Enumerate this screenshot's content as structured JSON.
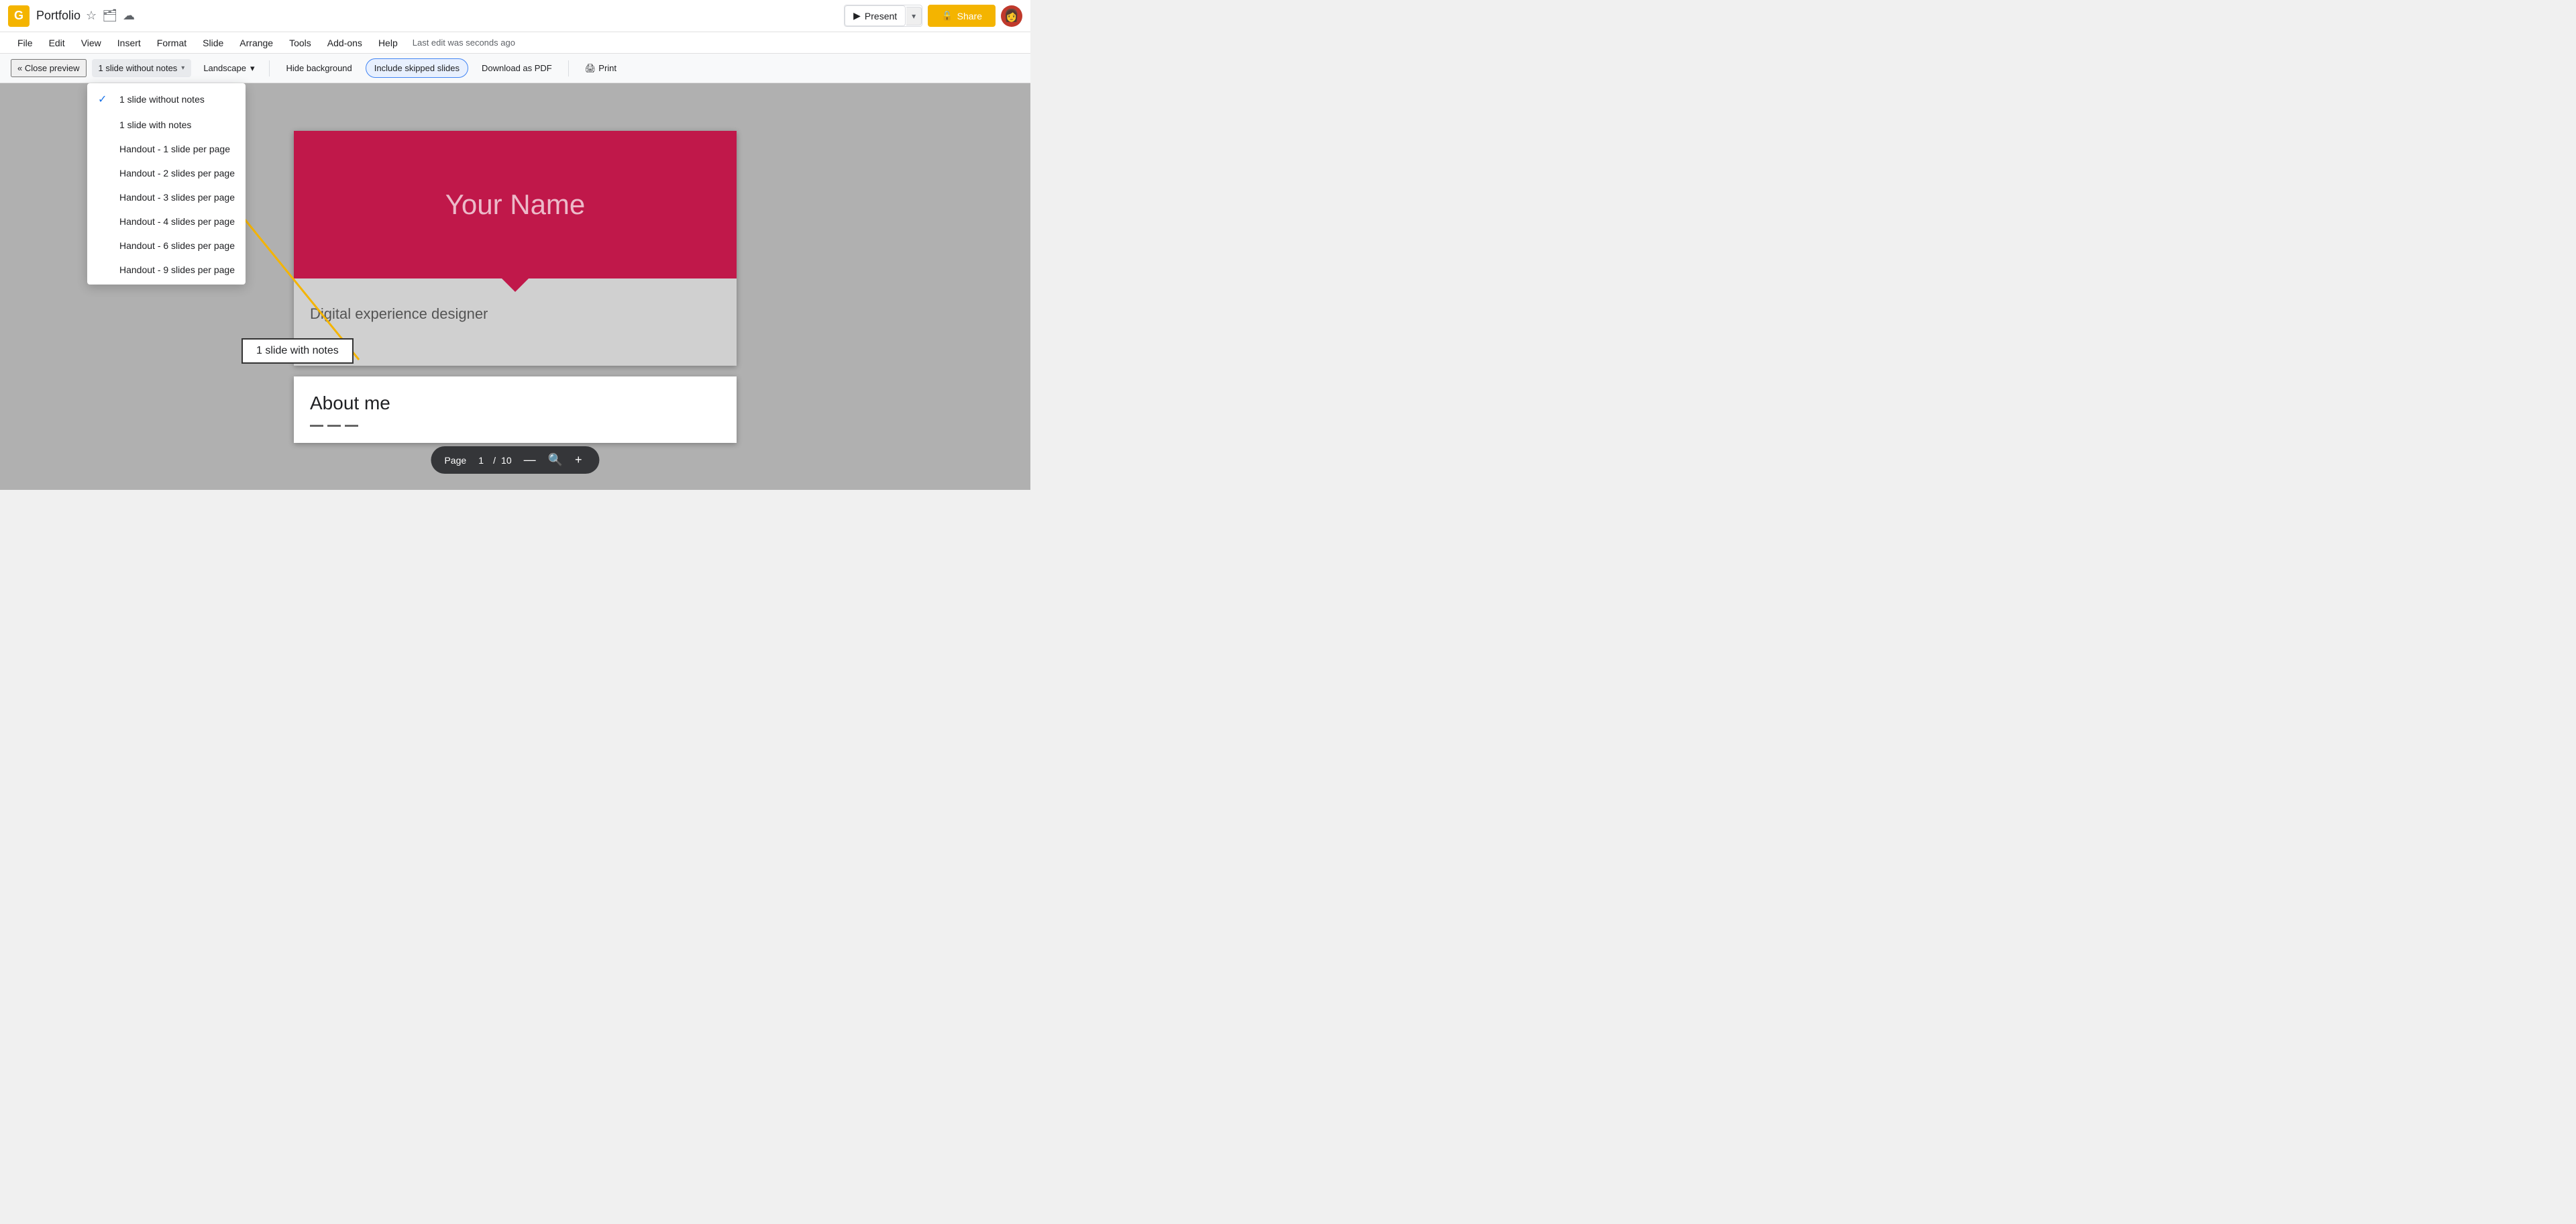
{
  "titlebar": {
    "app_icon": "G",
    "doc_title": "Portfolio",
    "present_label": "Present",
    "share_label": "Share"
  },
  "menubar": {
    "items": [
      "File",
      "Edit",
      "View",
      "Insert",
      "Format",
      "Slide",
      "Arrange",
      "Tools",
      "Add-ons",
      "Help"
    ],
    "last_edit": "Last edit was seconds ago"
  },
  "print_toolbar": {
    "close_preview": "« Close preview",
    "layout_label": "1 slide without notes",
    "landscape_label": "Landscape",
    "hide_bg_label": "Hide background",
    "include_skipped_label": "Include skipped slides",
    "download_pdf_label": "Download as PDF",
    "print_label": "Print"
  },
  "dropdown": {
    "items": [
      {
        "label": "1 slide without notes",
        "selected": true
      },
      {
        "label": "1 slide with notes",
        "selected": false
      },
      {
        "label": "Handout - 1 slide per page",
        "selected": false
      },
      {
        "label": "Handout - 2 slides per page",
        "selected": false
      },
      {
        "label": "Handout - 3 slides per page",
        "selected": false
      },
      {
        "label": "Handout - 4 slides per page",
        "selected": false
      },
      {
        "label": "Handout - 6 slides per page",
        "selected": false
      },
      {
        "label": "Handout - 9 slides per page",
        "selected": false
      }
    ]
  },
  "slide1": {
    "title": "Your Name",
    "subtitle": "Digital experience designer"
  },
  "slide2": {
    "title": "About me"
  },
  "page_bar": {
    "page_label": "Page",
    "current": "1",
    "total": "10"
  },
  "annotation": {
    "label": "1 slide with notes"
  }
}
